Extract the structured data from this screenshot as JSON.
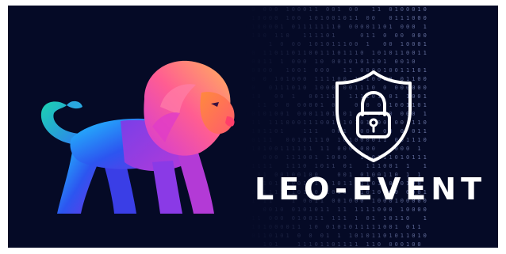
{
  "banner": {
    "brand_name": "LEO-EVENT",
    "background_color": "#050a26",
    "icons": {
      "mascot": "lion-icon",
      "security": "shield-lock-icon"
    }
  }
}
